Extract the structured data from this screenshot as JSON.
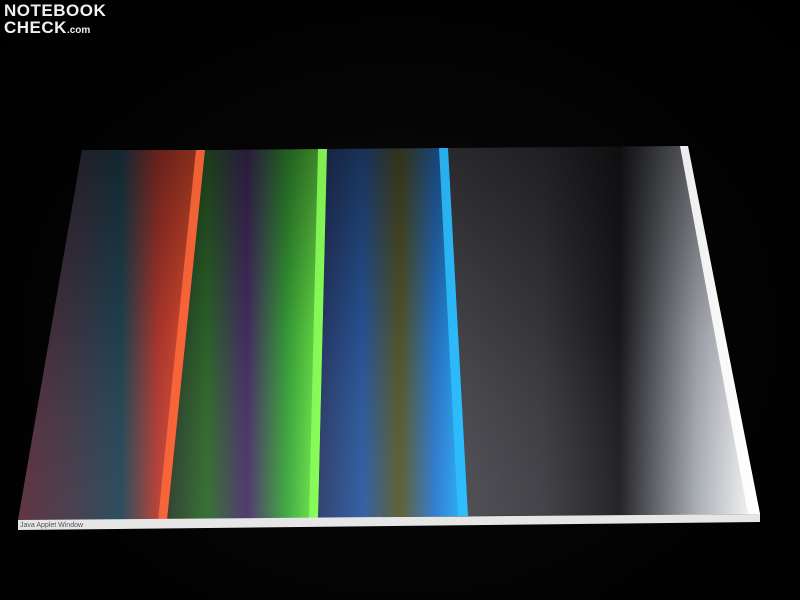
{
  "watermark": {
    "line1": "NOTEBOOK",
    "line2": "CHECK",
    "line2_suffix": ".com"
  },
  "screen": {
    "taskbar_label": "Java Applet Window",
    "bands": [
      {
        "color_name": "red",
        "accent": "#ff4a2a"
      },
      {
        "color_name": "green",
        "accent": "#66ff44"
      },
      {
        "color_name": "blue",
        "accent": "#22a6ff"
      },
      {
        "color_name": "gray",
        "accent": "#f4f4f4"
      }
    ]
  }
}
